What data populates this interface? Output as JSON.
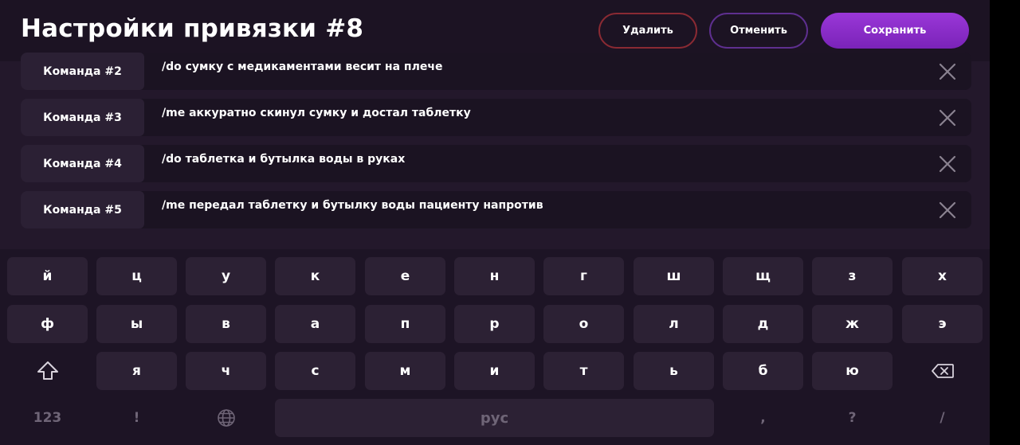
{
  "header": {
    "title": "Настройки привязки #8",
    "delete_label": "Удалить",
    "cancel_label": "Отменить",
    "save_label": "Сохранить"
  },
  "commands": [
    {
      "label": "Команда #2",
      "text": "/do сумку с медикаментами весит на плече"
    },
    {
      "label": "Команда #3",
      "text": "/me аккуратно скинул сумку и достал таблетку"
    },
    {
      "label": "Команда #4",
      "text": "/do таблетка и бутылка воды в руках"
    },
    {
      "label": "Команда #5",
      "text": "/me передал таблетку и бутылку воды пациенту напротив"
    }
  ],
  "keyboard": {
    "row1": [
      "й",
      "ц",
      "у",
      "к",
      "е",
      "н",
      "г",
      "ш",
      "щ",
      "з",
      "х"
    ],
    "row2": [
      "ф",
      "ы",
      "в",
      "а",
      "п",
      "р",
      "о",
      "л",
      "д",
      "ж",
      "э"
    ],
    "row3": [
      "я",
      "ч",
      "с",
      "м",
      "и",
      "т",
      "ь",
      "б",
      "ю"
    ],
    "row4": {
      "numbers": "123",
      "exclamation": "!",
      "space": "рус",
      "comma": ",",
      "question": "?",
      "slash": "/"
    },
    "icons": {
      "shift": "shift-icon",
      "backspace": "backspace-icon",
      "language": "globe-icon"
    }
  },
  "colors": {
    "background": "#23182b",
    "header": "#1c1323",
    "accent": "#8a2fc9",
    "delete_border": "#8a2a33",
    "cancel_border": "#5e2f8f",
    "key": "#2c2134"
  }
}
